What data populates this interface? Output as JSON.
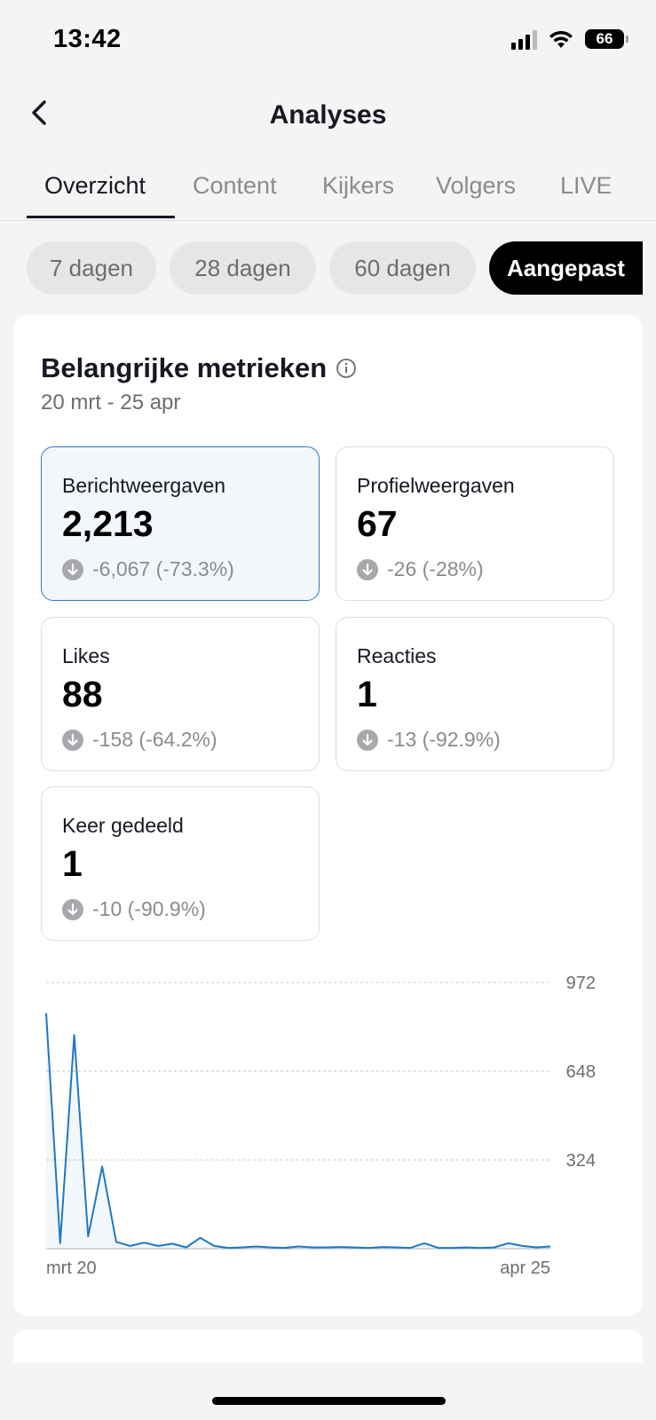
{
  "status_bar": {
    "time": "13:42",
    "battery": "66"
  },
  "nav": {
    "title": "Analyses",
    "back_icon": "chevron-left-icon"
  },
  "tabs": [
    {
      "label": "Overzicht",
      "active": true
    },
    {
      "label": "Content",
      "active": false
    },
    {
      "label": "Kijkers",
      "active": false
    },
    {
      "label": "Volgers",
      "active": false
    },
    {
      "label": "LIVE",
      "active": false
    }
  ],
  "ranges": [
    {
      "label": "7 dagen",
      "selected": false
    },
    {
      "label": "28 dagen",
      "selected": false
    },
    {
      "label": "60 dagen",
      "selected": false
    },
    {
      "label": "Aangepast",
      "selected": true
    }
  ],
  "key_metrics": {
    "title": "Belangrijke metrieken",
    "date_range": "20 mrt - 25 apr",
    "items": [
      {
        "label": "Berichtweergaven",
        "value": "2,213",
        "change": "-6,067 (-73.3%)",
        "selected": true
      },
      {
        "label": "Profielweergaven",
        "value": "67",
        "change": "-26 (-28%)",
        "selected": false
      },
      {
        "label": "Likes",
        "value": "88",
        "change": "-158 (-64.2%)",
        "selected": false
      },
      {
        "label": "Reacties",
        "value": "1",
        "change": "-13 (-92.9%)",
        "selected": false
      },
      {
        "label": "Keer gedeeld",
        "value": "1",
        "change": "-10 (-90.9%)",
        "selected": false
      }
    ]
  },
  "colors": {
    "accent": "#1f77c4",
    "selected_border": "#2b7ac9",
    "selected_bg": "#f3f7fc"
  },
  "chart_data": {
    "type": "area",
    "x_labels": [
      "mrt 20",
      "apr 25"
    ],
    "y_ticks": [
      324,
      648,
      972
    ],
    "ylim": [
      0,
      972
    ],
    "grid": true,
    "series": [
      {
        "values": [
          860,
          20,
          780,
          45,
          300,
          25,
          10,
          22,
          10,
          18,
          5,
          40,
          10,
          3,
          5,
          8,
          5,
          3,
          8,
          5,
          5,
          6,
          5,
          3,
          6,
          5,
          3,
          20,
          3,
          3,
          5,
          3,
          5,
          20,
          10,
          5,
          8
        ]
      }
    ]
  }
}
